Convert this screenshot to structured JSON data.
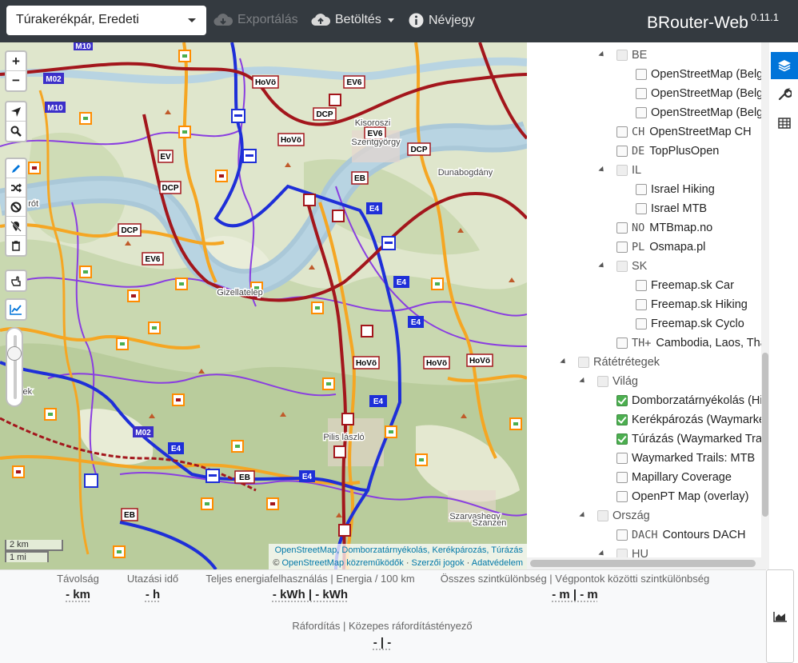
{
  "navbar": {
    "profile": "Túrakerékpár, Eredeti",
    "export_label": "Exportálás",
    "load_label": "Betöltés",
    "about_label": "Névjegy",
    "brand": "BRouter-Web",
    "version": "0.11.1"
  },
  "map": {
    "zoom_in": "+",
    "zoom_out": "−",
    "scale_km": "2 km",
    "scale_mi": "1 mi",
    "attribution_line1": "OpenStreetMap, Domborzatárnyékolás, Kerékpározás, Túrázás",
    "attribution_copy": "©",
    "attribution_osm": "OpenStreetMap közreműködők",
    "attribution_sep1": "·",
    "attribution_terms": "Szerzői jogok",
    "attribution_sep2": "·",
    "attribution_privacy": "Adatvédelem",
    "place_labels": [
      "Gizellatelep",
      "Kisoroszi",
      "Szentgyörgypuszta",
      "Pilisszentlászló",
      "Szarvashegy",
      "Szanzen",
      "Dunabogdány",
      "Pilisszentlászló"
    ],
    "route_signs": [
      "M10",
      "M02",
      "M10",
      "EV6",
      "HoVö",
      "DCP",
      "EV6",
      "HoVö",
      "EB",
      "E4",
      "DCP",
      "EV6",
      "DCP",
      "EV6",
      "E4",
      "E4",
      "HoVö",
      "HoVö",
      "HoVö",
      "E4",
      "M02",
      "E4",
      "EB",
      "E4",
      "EB"
    ]
  },
  "layers": {
    "items": [
      {
        "label": "BE",
        "code": "",
        "state": "indeterminate",
        "level": 1,
        "arrow": true
      },
      {
        "label": "OpenStreetMap (Belgian",
        "code": "",
        "state": "unchecked",
        "level": 2
      },
      {
        "label": "OpenStreetMap (Belgian",
        "code": "",
        "state": "unchecked",
        "level": 2
      },
      {
        "label": "OpenStreetMap (Belgian",
        "code": "",
        "state": "unchecked",
        "level": 2
      },
      {
        "label": "OpenStreetMap CH",
        "code": "CH",
        "state": "unchecked",
        "level": 1
      },
      {
        "label": "TopPlusOpen",
        "code": "DE",
        "state": "unchecked",
        "level": 1
      },
      {
        "label": "IL",
        "code": "",
        "state": "indeterminate",
        "level": 1,
        "arrow": true
      },
      {
        "label": "Israel Hiking",
        "code": "",
        "state": "unchecked",
        "level": 2
      },
      {
        "label": "Israel MTB",
        "code": "",
        "state": "unchecked",
        "level": 2
      },
      {
        "label": "MTBmap.no",
        "code": "NO",
        "state": "unchecked",
        "level": 1
      },
      {
        "label": "Osmapa.pl",
        "code": "PL",
        "state": "unchecked",
        "level": 1
      },
      {
        "label": "SK",
        "code": "",
        "state": "indeterminate",
        "level": 1,
        "arrow": true
      },
      {
        "label": "Freemap.sk Car",
        "code": "",
        "state": "unchecked",
        "level": 2
      },
      {
        "label": "Freemap.sk Hiking",
        "code": "",
        "state": "unchecked",
        "level": 2
      },
      {
        "label": "Freemap.sk Cyclo",
        "code": "",
        "state": "unchecked",
        "level": 2
      },
      {
        "label": "Cambodia, Laos, Thaila",
        "code": "TH+",
        "state": "unchecked",
        "level": 1
      },
      {
        "label": "Rátétrétegek",
        "code": "",
        "state": "indeterminate",
        "level": -1,
        "arrow": true
      },
      {
        "label": "Világ",
        "code": "",
        "state": "indeterminate",
        "level": 0,
        "arrow": true
      },
      {
        "label": "Domborzatárnyékolás (Hike &",
        "code": "",
        "state": "checked",
        "level": 1
      },
      {
        "label": "Kerékpározás (Waymarked T",
        "code": "",
        "state": "checked",
        "level": 1
      },
      {
        "label": "Túrázás (Waymarked Trails)",
        "code": "",
        "state": "checked",
        "level": 1
      },
      {
        "label": "Waymarked Trails: MTB",
        "code": "",
        "state": "unchecked",
        "level": 1
      },
      {
        "label": "Mapillary Coverage",
        "code": "",
        "state": "unchecked",
        "level": 1
      },
      {
        "label": "OpenPT Map (overlay)",
        "code": "",
        "state": "unchecked",
        "level": 1
      },
      {
        "label": "Ország",
        "code": "",
        "state": "indeterminate",
        "level": 0,
        "arrow": true
      },
      {
        "label": "Contours DACH",
        "code": "DACH",
        "state": "unchecked",
        "level": 1
      },
      {
        "label": "HU",
        "code": "",
        "state": "indeterminate",
        "level": 1,
        "arrow": true
      }
    ]
  },
  "stats": {
    "distance_label": "Távolság",
    "distance_value": "- km",
    "time_label": "Utazási idő",
    "time_value": "- h",
    "energy_label": "Teljes energiafelhasználás | Energia / 100 km",
    "energy_value": "- kWh | - kWh",
    "ascend_label": "Összes szintkülönbség | Végpontok közötti szintkülönbség",
    "ascend_value": "- m | - m",
    "cost_label": "Ráfordítás | Közepes ráfordítástényező",
    "cost_value": "- | -"
  },
  "colors": {
    "navbar_bg": "#343a40",
    "accent": "#0074d9",
    "checked": "#4caf50",
    "route_red": "#a3161c",
    "hiking_blue": "#1e2fd8",
    "road_orange": "#f5a623",
    "cycle_purple": "#8a3ee0",
    "river": "#aac8d8"
  },
  "icons": {
    "export": "cloud-download-icon",
    "load": "cloud-upload-icon",
    "about": "info-circle-icon",
    "layers": "layers-icon",
    "settings": "wrench-icon",
    "table": "table-icon",
    "elevation": "area-chart-icon"
  }
}
